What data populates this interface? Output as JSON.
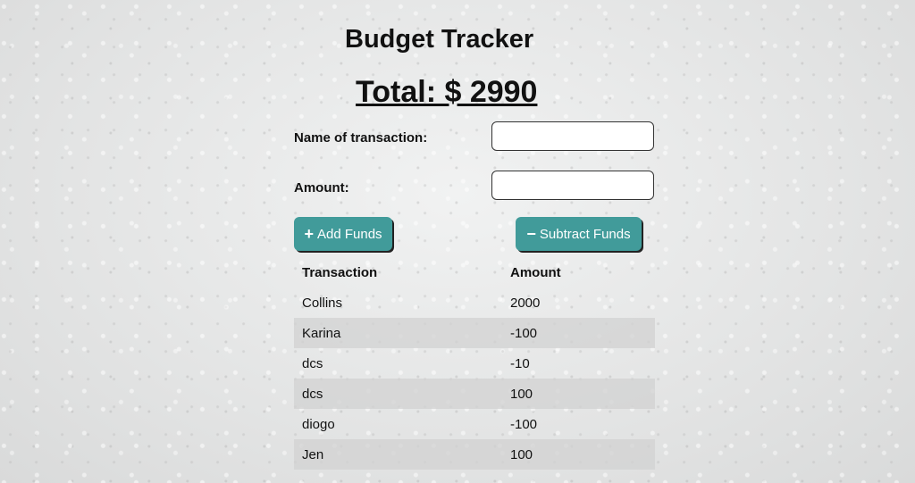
{
  "app": {
    "title": "Budget Tracker",
    "total_text": "Total: $ 2990"
  },
  "form": {
    "name_label": "Name of transaction:",
    "name_value": "",
    "amount_label": "Amount:",
    "amount_value": ""
  },
  "actions": {
    "add_label": "Add Funds",
    "add_icon": "plus-icon",
    "subtract_label": "Subtract Funds",
    "subtract_icon": "minus-icon",
    "button_color": "#419b9a"
  },
  "table": {
    "headers": [
      "Transaction",
      "Amount"
    ],
    "rows": [
      {
        "name": "Collins",
        "amount": "2000"
      },
      {
        "name": "Karina",
        "amount": "-100"
      },
      {
        "name": "dcs",
        "amount": "-10"
      },
      {
        "name": "dcs",
        "amount": "100"
      },
      {
        "name": "diogo",
        "amount": "-100"
      },
      {
        "name": "Jen",
        "amount": "100"
      }
    ]
  }
}
